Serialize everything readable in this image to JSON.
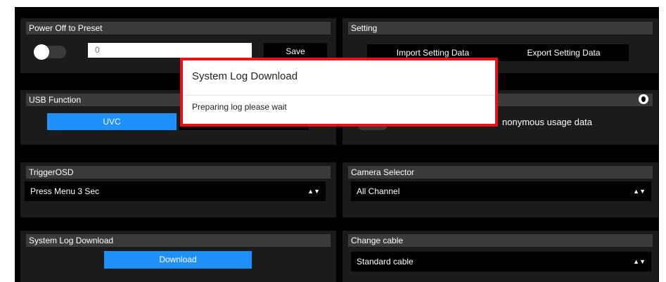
{
  "power_off": {
    "title": "Power Off to Preset",
    "toggle_on": false,
    "value": "0",
    "save_label": "Save"
  },
  "setting": {
    "title": "Setting",
    "import_label": "Import Setting Data",
    "export_label": "Export Setting Data"
  },
  "usb": {
    "title": "USB Function",
    "uvc_label": "UVC"
  },
  "usage": {
    "text_partial": "nonymous usage data",
    "toggle_on": false
  },
  "trigger_osd": {
    "title": "TriggerOSD",
    "selected": "Press Menu 3 Sec"
  },
  "camera_selector": {
    "title": "Camera Selector",
    "selected": "All Channel"
  },
  "system_log": {
    "title": "System Log Download",
    "download_label": "Download"
  },
  "change_cable": {
    "title": "Change cable",
    "selected": "Standard cable"
  },
  "modal": {
    "title": "System Log Download",
    "message": "Preparing log please wait"
  },
  "colors": {
    "accent_blue": "#1e90ff",
    "modal_border": "#e8121b",
    "panel": "#1b1b1b",
    "header": "#3b3b3b"
  }
}
